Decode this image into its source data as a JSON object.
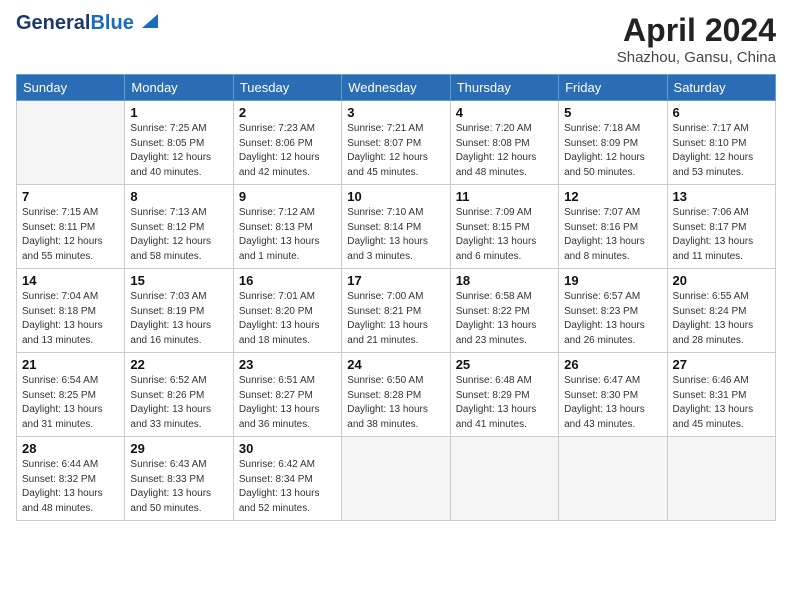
{
  "header": {
    "logo_line1": "General",
    "logo_line2": "Blue",
    "main_title": "April 2024",
    "sub_title": "Shazhou, Gansu, China"
  },
  "weekdays": [
    "Sunday",
    "Monday",
    "Tuesday",
    "Wednesday",
    "Thursday",
    "Friday",
    "Saturday"
  ],
  "weeks": [
    [
      {
        "day": "",
        "info": ""
      },
      {
        "day": "1",
        "info": "Sunrise: 7:25 AM\nSunset: 8:05 PM\nDaylight: 12 hours\nand 40 minutes."
      },
      {
        "day": "2",
        "info": "Sunrise: 7:23 AM\nSunset: 8:06 PM\nDaylight: 12 hours\nand 42 minutes."
      },
      {
        "day": "3",
        "info": "Sunrise: 7:21 AM\nSunset: 8:07 PM\nDaylight: 12 hours\nand 45 minutes."
      },
      {
        "day": "4",
        "info": "Sunrise: 7:20 AM\nSunset: 8:08 PM\nDaylight: 12 hours\nand 48 minutes."
      },
      {
        "day": "5",
        "info": "Sunrise: 7:18 AM\nSunset: 8:09 PM\nDaylight: 12 hours\nand 50 minutes."
      },
      {
        "day": "6",
        "info": "Sunrise: 7:17 AM\nSunset: 8:10 PM\nDaylight: 12 hours\nand 53 minutes."
      }
    ],
    [
      {
        "day": "7",
        "info": "Sunrise: 7:15 AM\nSunset: 8:11 PM\nDaylight: 12 hours\nand 55 minutes."
      },
      {
        "day": "8",
        "info": "Sunrise: 7:13 AM\nSunset: 8:12 PM\nDaylight: 12 hours\nand 58 minutes."
      },
      {
        "day": "9",
        "info": "Sunrise: 7:12 AM\nSunset: 8:13 PM\nDaylight: 13 hours\nand 1 minute."
      },
      {
        "day": "10",
        "info": "Sunrise: 7:10 AM\nSunset: 8:14 PM\nDaylight: 13 hours\nand 3 minutes."
      },
      {
        "day": "11",
        "info": "Sunrise: 7:09 AM\nSunset: 8:15 PM\nDaylight: 13 hours\nand 6 minutes."
      },
      {
        "day": "12",
        "info": "Sunrise: 7:07 AM\nSunset: 8:16 PM\nDaylight: 13 hours\nand 8 minutes."
      },
      {
        "day": "13",
        "info": "Sunrise: 7:06 AM\nSunset: 8:17 PM\nDaylight: 13 hours\nand 11 minutes."
      }
    ],
    [
      {
        "day": "14",
        "info": "Sunrise: 7:04 AM\nSunset: 8:18 PM\nDaylight: 13 hours\nand 13 minutes."
      },
      {
        "day": "15",
        "info": "Sunrise: 7:03 AM\nSunset: 8:19 PM\nDaylight: 13 hours\nand 16 minutes."
      },
      {
        "day": "16",
        "info": "Sunrise: 7:01 AM\nSunset: 8:20 PM\nDaylight: 13 hours\nand 18 minutes."
      },
      {
        "day": "17",
        "info": "Sunrise: 7:00 AM\nSunset: 8:21 PM\nDaylight: 13 hours\nand 21 minutes."
      },
      {
        "day": "18",
        "info": "Sunrise: 6:58 AM\nSunset: 8:22 PM\nDaylight: 13 hours\nand 23 minutes."
      },
      {
        "day": "19",
        "info": "Sunrise: 6:57 AM\nSunset: 8:23 PM\nDaylight: 13 hours\nand 26 minutes."
      },
      {
        "day": "20",
        "info": "Sunrise: 6:55 AM\nSunset: 8:24 PM\nDaylight: 13 hours\nand 28 minutes."
      }
    ],
    [
      {
        "day": "21",
        "info": "Sunrise: 6:54 AM\nSunset: 8:25 PM\nDaylight: 13 hours\nand 31 minutes."
      },
      {
        "day": "22",
        "info": "Sunrise: 6:52 AM\nSunset: 8:26 PM\nDaylight: 13 hours\nand 33 minutes."
      },
      {
        "day": "23",
        "info": "Sunrise: 6:51 AM\nSunset: 8:27 PM\nDaylight: 13 hours\nand 36 minutes."
      },
      {
        "day": "24",
        "info": "Sunrise: 6:50 AM\nSunset: 8:28 PM\nDaylight: 13 hours\nand 38 minutes."
      },
      {
        "day": "25",
        "info": "Sunrise: 6:48 AM\nSunset: 8:29 PM\nDaylight: 13 hours\nand 41 minutes."
      },
      {
        "day": "26",
        "info": "Sunrise: 6:47 AM\nSunset: 8:30 PM\nDaylight: 13 hours\nand 43 minutes."
      },
      {
        "day": "27",
        "info": "Sunrise: 6:46 AM\nSunset: 8:31 PM\nDaylight: 13 hours\nand 45 minutes."
      }
    ],
    [
      {
        "day": "28",
        "info": "Sunrise: 6:44 AM\nSunset: 8:32 PM\nDaylight: 13 hours\nand 48 minutes."
      },
      {
        "day": "29",
        "info": "Sunrise: 6:43 AM\nSunset: 8:33 PM\nDaylight: 13 hours\nand 50 minutes."
      },
      {
        "day": "30",
        "info": "Sunrise: 6:42 AM\nSunset: 8:34 PM\nDaylight: 13 hours\nand 52 minutes."
      },
      {
        "day": "",
        "info": ""
      },
      {
        "day": "",
        "info": ""
      },
      {
        "day": "",
        "info": ""
      },
      {
        "day": "",
        "info": ""
      }
    ]
  ]
}
